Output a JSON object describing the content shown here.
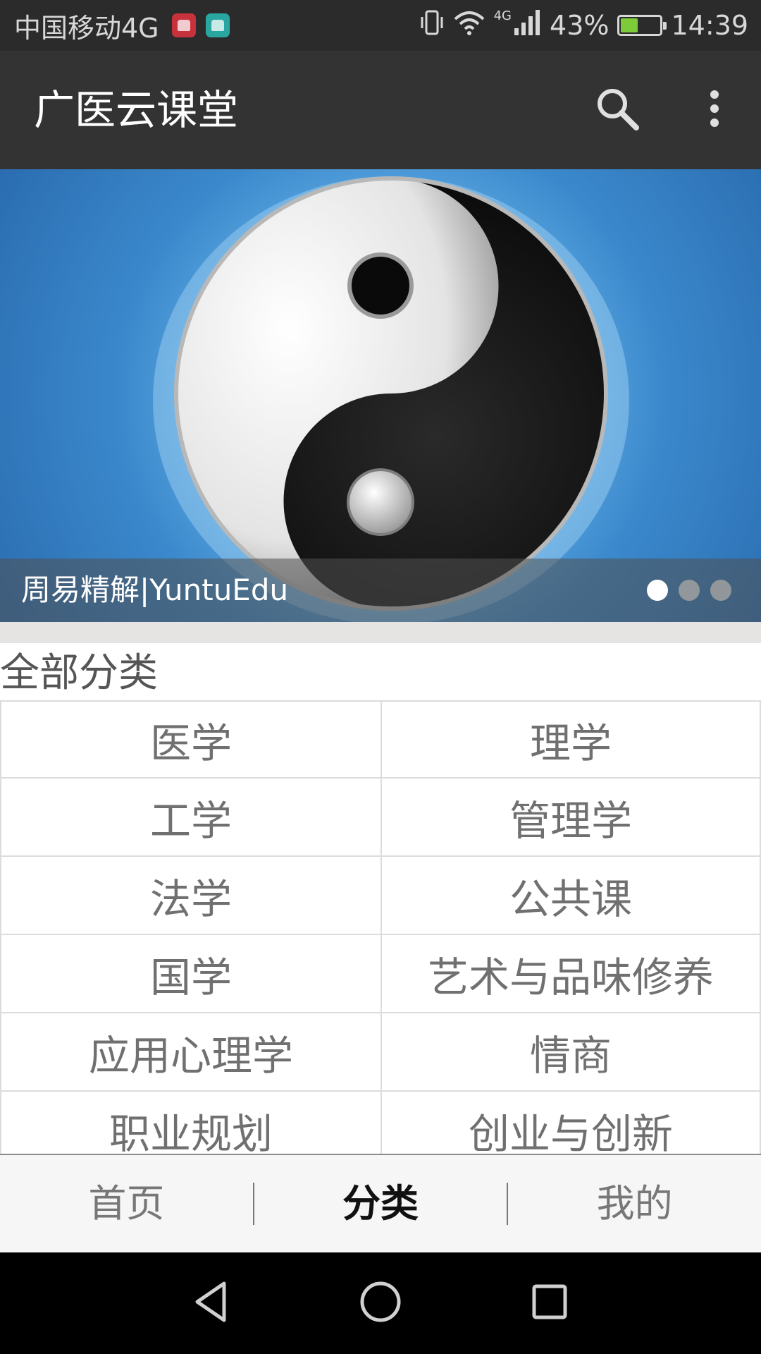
{
  "status_bar": {
    "carrier": "中国移动4G",
    "network_small": "4G",
    "battery_percent": "43%",
    "battery_level": 0.43,
    "time": "14:39"
  },
  "app_bar": {
    "title": "广医云课堂",
    "search_icon": "search-icon",
    "more_icon": "more-vert-icon"
  },
  "banner": {
    "caption": "周易精解|YuntuEdu",
    "slide_count": 3,
    "active_slide": 1
  },
  "categories": {
    "title": "全部分类",
    "rows": [
      [
        "医学",
        "理学"
      ],
      [
        "工学",
        "管理学"
      ],
      [
        "法学",
        "公共课"
      ],
      [
        "国学",
        "艺术与品味修养"
      ],
      [
        "应用心理学",
        "情商"
      ],
      [
        "职业规划",
        "创业与创新"
      ]
    ]
  },
  "tabs": [
    {
      "label": "首页",
      "active": false
    },
    {
      "label": "分类",
      "active": true
    },
    {
      "label": "我的",
      "active": false
    }
  ],
  "colors": {
    "status_bar": "#2b2b2b",
    "app_bar": "#333333",
    "banner_blue": "#3b88cc",
    "cell_text": "#707070"
  }
}
